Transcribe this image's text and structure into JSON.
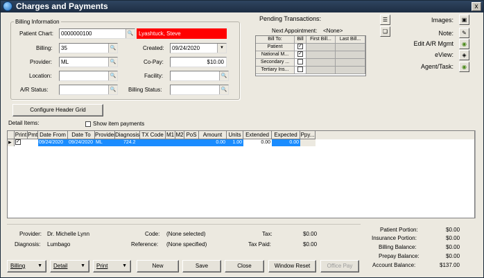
{
  "window": {
    "title": "Charges and Payments",
    "close_glyph": "x"
  },
  "billing_info": {
    "title": "Billing Information",
    "patient_chart_label": "Patient Chart:",
    "patient_chart_value": "0000000100",
    "patient_name": "Lyashtuck, Steve",
    "billing_label": "Billing:",
    "billing_value": "35",
    "created_label": "Created:",
    "created_value": "09/24/2020",
    "provider_label": "Provider:",
    "provider_value": "ML",
    "copay_label": "Co-Pay:",
    "copay_value": "$10.00",
    "location_label": "Location:",
    "location_value": "",
    "facility_label": "Facility:",
    "facility_value": "",
    "ar_status_label": "A/R Status:",
    "ar_status_value": "",
    "billing_status_label": "Billing Status:",
    "billing_status_value": ""
  },
  "pending": {
    "title": "Pending Transactions:",
    "next_appt_label": "Next Appointment:",
    "next_appt_value": "<None>",
    "headers": [
      "Bill To:",
      "Bill",
      "First Bill...",
      "Last Bill..."
    ],
    "rows": [
      {
        "name": "Patient",
        "bill": true
      },
      {
        "name": "National M...",
        "bill": true
      },
      {
        "name": "Secondary ...",
        "bill": false
      },
      {
        "name": "Tertiary Ins...",
        "bill": false
      }
    ]
  },
  "side_links": {
    "images": "Images:",
    "note": "Note:",
    "edit_ar": "Edit A/R Mgmt",
    "eview": "eView:",
    "agent_task": "Agent/Task:"
  },
  "configure_button": "Configure Header Grid",
  "detail": {
    "label": "Detail Items:",
    "show_item_payments": "Show item payments",
    "columns": [
      "Print",
      "Pmt",
      "Date From",
      "Date To",
      "Provider",
      "Diagnosis",
      "TX Code",
      "M1",
      "M2",
      "PoS",
      "Amount",
      "Units",
      "Extended",
      "Expected",
      "Ppy..."
    ],
    "row": {
      "print": true,
      "date_from": "09/24/2020",
      "date_to": "09/24/2020",
      "provider": "ML",
      "diagnosis": "724.2",
      "amount": "0.00",
      "units": "1.00",
      "extended": "0.00",
      "expected": "0.00"
    }
  },
  "summary": {
    "provider_label": "Provider:",
    "provider_value": "Dr. Michelle Lynn",
    "diagnosis_label": "Diagnosis:",
    "diagnosis_value": "Lumbago",
    "code_label": "Code:",
    "code_value": "(None selected)",
    "reference_label": "Reference:",
    "reference_value": "(None specified)",
    "tax_label": "Tax:",
    "tax_value": "$0.00",
    "tax_paid_label": "Tax Paid:",
    "tax_paid_value": "$0.00"
  },
  "balances": {
    "patient_portion_label": "Patient Portion:",
    "patient_portion_value": "$0.00",
    "insurance_portion_label": "Insurance Portion:",
    "insurance_portion_value": "$0.00",
    "billing_balance_label": "Billing Balance:",
    "billing_balance_value": "$0.00",
    "prepay_balance_label": "Prepay Balance:",
    "prepay_balance_value": "$0.00",
    "account_balance_label": "Account Balance:",
    "account_balance_value": "$137.00"
  },
  "bottom_buttons": {
    "billing": "Billing",
    "detail": "Detail",
    "print": "Print",
    "new": "New",
    "save": "Save",
    "close": "Close",
    "window_reset": "Window Reset",
    "office_pay": "Office Pay"
  },
  "colors": {
    "patient_name_bg": "#ff0000",
    "selection": "#1a8cff"
  }
}
